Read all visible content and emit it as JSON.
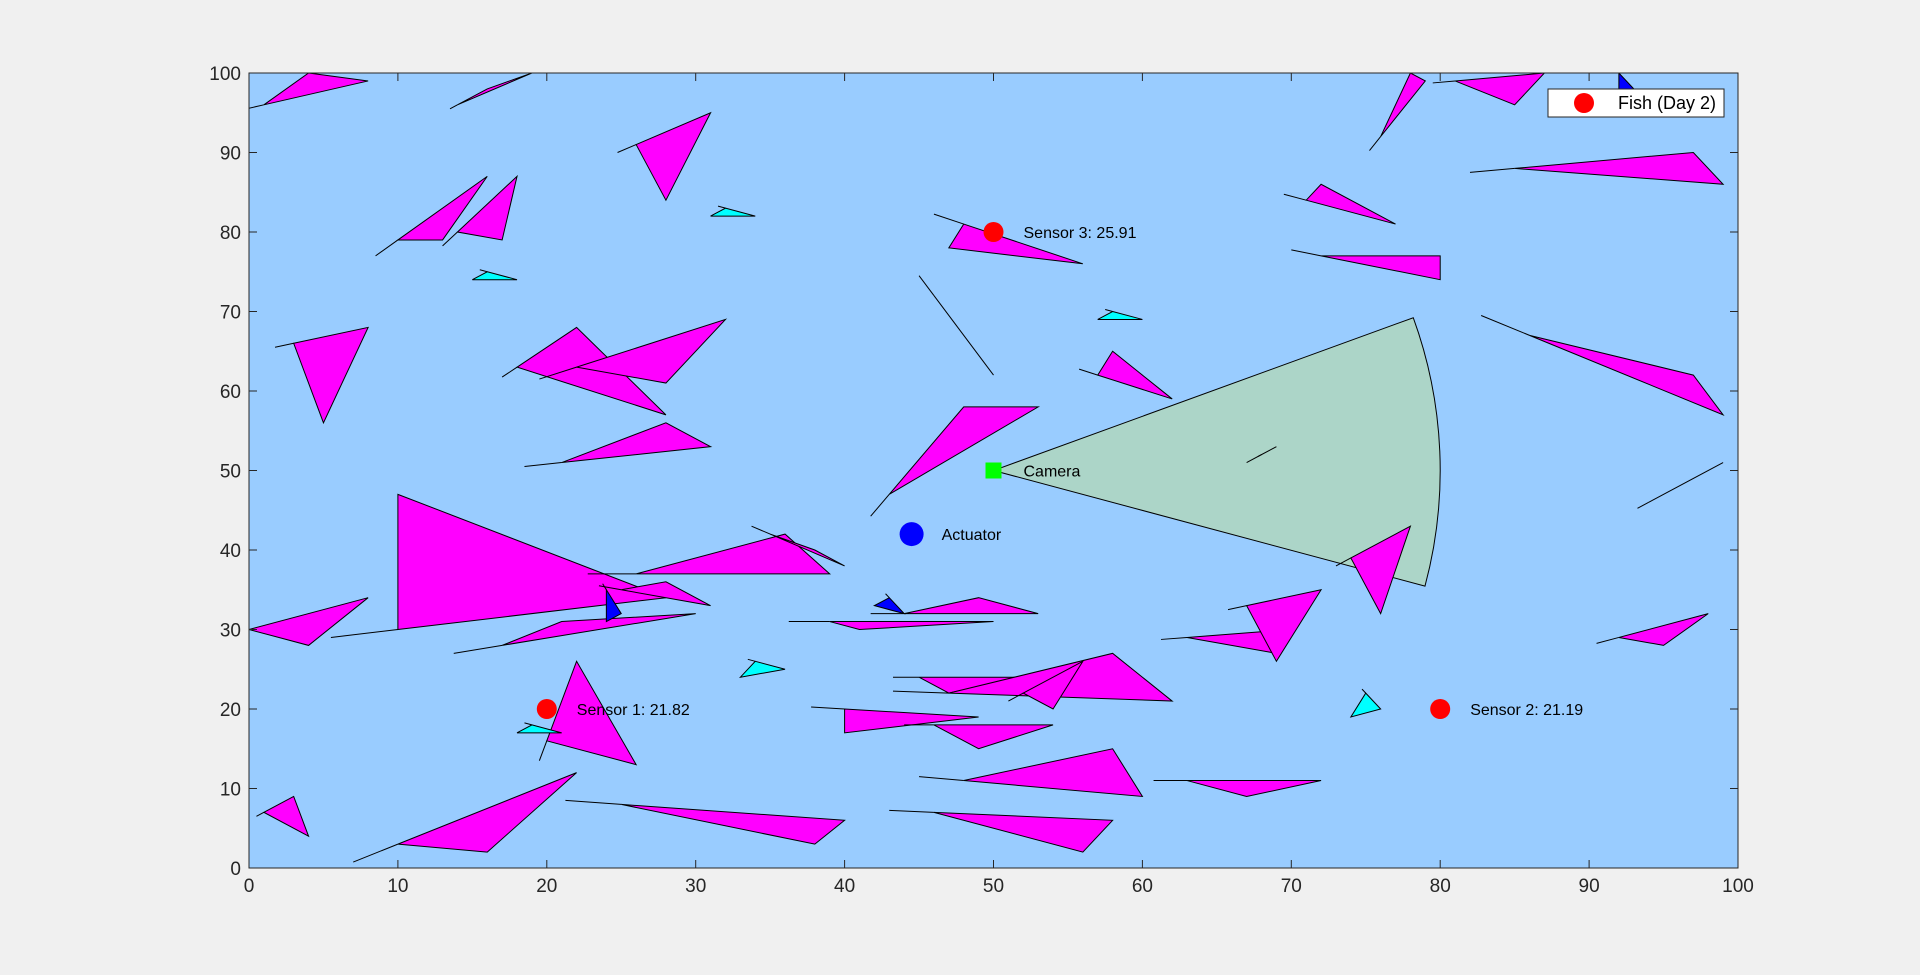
{
  "chart_data": {
    "type": "scatter",
    "xlim": [
      0,
      100
    ],
    "ylim": [
      0,
      100
    ],
    "x_ticks": [
      0,
      10,
      20,
      30,
      40,
      50,
      60,
      70,
      80,
      90,
      100
    ],
    "y_ticks": [
      0,
      10,
      20,
      30,
      40,
      50,
      60,
      70,
      80,
      90,
      100
    ],
    "grid": false,
    "legend": {
      "position": "top-right",
      "entries": [
        {
          "label": "Fish (Day 2)",
          "marker": "circle",
          "color": "#ff0000"
        }
      ]
    },
    "colors": {
      "plot_background": "#99ccff",
      "fish_large": "#ff00ff",
      "fish_small": "#00ffff",
      "fish_dark": "#0000ff",
      "camera_fov": "#acd5c8",
      "camera_marker": "#00ff00",
      "sensor_marker": "#ff0000",
      "actuator_marker": "#0000ff"
    },
    "sensors": [
      {
        "label": "Sensor 1: 21.82",
        "x": 20,
        "y": 20
      },
      {
        "label": "Sensor 2: 21.19",
        "x": 80,
        "y": 20
      },
      {
        "label": "Sensor 3: 25.91",
        "x": 50,
        "y": 80
      }
    ],
    "actuator": {
      "label": "Actuator",
      "x": 44.5,
      "y": 42
    },
    "camera": {
      "label": "Camera",
      "x": 50,
      "y": 50,
      "fov_radius": 30,
      "fov_start_deg": -15,
      "fov_end_deg": 20
    },
    "fish_large": [
      [
        [
          1,
          96
        ],
        [
          8,
          99
        ],
        [
          4,
          100
        ]
      ],
      [
        [
          14,
          96
        ],
        [
          16,
          98
        ],
        [
          19,
          100
        ]
      ],
      [
        [
          10,
          79
        ],
        [
          16,
          87
        ],
        [
          13,
          79
        ]
      ],
      [
        [
          14,
          80
        ],
        [
          18,
          87
        ],
        [
          17,
          79
        ]
      ],
      [
        [
          3,
          66
        ],
        [
          8,
          68
        ],
        [
          5,
          56
        ]
      ],
      [
        [
          18,
          63
        ],
        [
          22,
          68
        ],
        [
          28,
          57
        ]
      ],
      [
        [
          22,
          63
        ],
        [
          32,
          69
        ],
        [
          28,
          61
        ]
      ],
      [
        [
          21,
          51
        ],
        [
          31,
          53
        ],
        [
          28,
          56
        ]
      ],
      [
        [
          26,
          91
        ],
        [
          31,
          95
        ],
        [
          28,
          84
        ]
      ],
      [
        [
          10,
          30
        ],
        [
          28,
          34
        ],
        [
          10,
          47
        ]
      ],
      [
        [
          17,
          28
        ],
        [
          30,
          32
        ],
        [
          21,
          31
        ]
      ],
      [
        [
          25,
          35
        ],
        [
          31,
          33
        ],
        [
          28,
          36
        ]
      ],
      [
        [
          26,
          37
        ],
        [
          39,
          37
        ],
        [
          36,
          42
        ]
      ],
      [
        [
          35,
          42
        ],
        [
          40,
          38
        ],
        [
          38,
          40
        ]
      ],
      [
        [
          10,
          3
        ],
        [
          22,
          12
        ],
        [
          16,
          2
        ]
      ],
      [
        [
          25,
          8
        ],
        [
          40,
          6
        ],
        [
          38,
          3
        ]
      ],
      [
        [
          40,
          20
        ],
        [
          49,
          19
        ],
        [
          40,
          17
        ]
      ],
      [
        [
          20,
          16
        ],
        [
          22,
          26
        ],
        [
          26,
          13
        ]
      ],
      [
        [
          39,
          31
        ],
        [
          50,
          31
        ],
        [
          41,
          30
        ]
      ],
      [
        [
          44,
          32
        ],
        [
          53,
          32
        ],
        [
          49,
          34
        ]
      ],
      [
        [
          45,
          24
        ],
        [
          52,
          24
        ],
        [
          47,
          22
        ]
      ],
      [
        [
          47,
          22
        ],
        [
          62,
          21
        ],
        [
          58,
          27
        ]
      ],
      [
        [
          46,
          18
        ],
        [
          54,
          18
        ],
        [
          49,
          15
        ]
      ],
      [
        [
          48,
          11
        ],
        [
          60,
          9
        ],
        [
          58,
          15
        ]
      ],
      [
        [
          52,
          22
        ],
        [
          56,
          26
        ],
        [
          54,
          20
        ]
      ],
      [
        [
          46,
          7
        ],
        [
          58,
          6
        ],
        [
          56,
          2
        ]
      ],
      [
        [
          43,
          47
        ],
        [
          48,
          58
        ],
        [
          53,
          58
        ]
      ],
      [
        [
          46,
          72
        ],
        [
          50,
          62
        ],
        [
          48,
          67
        ]
      ],
      [
        [
          48,
          81
        ],
        [
          56,
          76
        ],
        [
          47,
          78
        ]
      ],
      [
        [
          57,
          62
        ],
        [
          62,
          59
        ],
        [
          58,
          65
        ]
      ],
      [
        [
          63,
          11
        ],
        [
          72,
          11
        ],
        [
          67,
          9
        ]
      ],
      [
        [
          63,
          29
        ],
        [
          70,
          30
        ],
        [
          69,
          27
        ]
      ],
      [
        [
          67,
          33
        ],
        [
          72,
          35
        ],
        [
          69,
          26
        ]
      ],
      [
        [
          71,
          84
        ],
        [
          77,
          81
        ],
        [
          72,
          86
        ]
      ],
      [
        [
          72,
          77
        ],
        [
          80,
          74
        ],
        [
          80,
          77
        ]
      ],
      [
        [
          74,
          39
        ],
        [
          78,
          43
        ],
        [
          76,
          32
        ]
      ],
      [
        [
          76,
          92
        ],
        [
          79,
          99
        ],
        [
          78,
          100
        ]
      ],
      [
        [
          81,
          99
        ],
        [
          87,
          100
        ],
        [
          85,
          96
        ]
      ],
      [
        [
          85,
          88
        ],
        [
          97,
          90
        ],
        [
          99,
          86
        ]
      ],
      [
        [
          86,
          67
        ],
        [
          99,
          57
        ],
        [
          97,
          62
        ]
      ],
      [
        [
          94,
          46
        ],
        [
          97,
          49
        ],
        [
          99,
          51
        ]
      ],
      [
        [
          92,
          29
        ],
        [
          98,
          32
        ],
        [
          95,
          28
        ]
      ],
      [
        [
          0,
          30
        ],
        [
          8,
          34
        ],
        [
          4,
          28
        ]
      ],
      [
        [
          1,
          7
        ],
        [
          3,
          9
        ],
        [
          4,
          4
        ]
      ]
    ],
    "fish_small": [
      [
        [
          16,
          75
        ],
        [
          18,
          74
        ],
        [
          15,
          74
        ]
      ],
      [
        [
          32,
          83
        ],
        [
          34,
          82
        ],
        [
          31,
          82
        ]
      ],
      [
        [
          34,
          26
        ],
        [
          36,
          25
        ],
        [
          33,
          24
        ]
      ],
      [
        [
          58,
          70
        ],
        [
          60,
          69
        ],
        [
          57,
          69
        ]
      ],
      [
        [
          68,
          52
        ],
        [
          69,
          53
        ],
        [
          67,
          51
        ]
      ],
      [
        [
          75,
          22
        ],
        [
          76,
          20
        ],
        [
          74,
          19
        ]
      ],
      [
        [
          19,
          18
        ],
        [
          21,
          17
        ],
        [
          18,
          17
        ]
      ]
    ],
    "fish_dark": [
      [
        [
          24,
          35
        ],
        [
          25,
          32
        ],
        [
          24,
          31
        ]
      ],
      [
        [
          43,
          34
        ],
        [
          44,
          32
        ],
        [
          42,
          33
        ]
      ],
      [
        [
          92,
          100
        ],
        [
          93,
          98
        ],
        [
          92,
          97
        ]
      ]
    ]
  }
}
